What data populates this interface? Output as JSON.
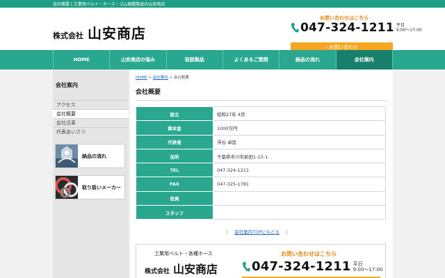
{
  "topbar": {
    "text": "会社概要 | 工業用ベルト・ホース・ゴム樹脂製品の山安商店"
  },
  "header": {
    "logo_small": "株式会社",
    "logo_big": "山安商店",
    "contact_heading": "お問い合わせはこちら",
    "phone": "047-324-1211",
    "hours_line1": "平日",
    "hours_line2": "9:00〜17:00",
    "contact_button": "› お問い合わせ"
  },
  "nav": [
    {
      "label": "HOME"
    },
    {
      "label": "山安商店の強み"
    },
    {
      "label": "取扱製品"
    },
    {
      "label": "よくあるご質問"
    },
    {
      "label": "納品の流れ"
    },
    {
      "label": "会社案内"
    }
  ],
  "sidebar": {
    "title": "会社案内",
    "items": [
      {
        "label": "アクセス"
      },
      {
        "label": "会社概要"
      },
      {
        "label": "会社沿革"
      },
      {
        "label": "代表あいさつ"
      }
    ],
    "banners": [
      {
        "label": "納品の流れ"
      },
      {
        "label": "取り扱いメーカー"
      }
    ]
  },
  "breadcrumb": {
    "home": "HOME",
    "sep": ">",
    "company": "会社案内",
    "current": "会社概要"
  },
  "page_title": "会社概要",
  "company_info": [
    {
      "key": "設立",
      "value": "昭和27年 4月"
    },
    {
      "key": "資本金",
      "value": "1000万円"
    },
    {
      "key": "代表者",
      "value": "浮谷 卓匡"
    },
    {
      "key": "住所",
      "value": "千葉県市川市新田1-15-1"
    },
    {
      "key": "TEL",
      "value": "047-324-1211"
    },
    {
      "key": "FAX",
      "value": "047-325-1781"
    },
    {
      "key": "役員",
      "value": ""
    },
    {
      "key": "スタッフ",
      "value": ""
    }
  ],
  "back_link": {
    "bar": "|",
    "label": "会社案内TOPにもどる"
  },
  "footer_box": {
    "subtitle": "工業用ベルト・各種ホース",
    "logo_small": "株式会社",
    "logo_big": "山安商店",
    "contact_heading": "お問い合わせはこちら",
    "phone": "047-324-1211",
    "hours_line1": "平日",
    "hours_line2": "9:00〜17:00"
  },
  "colors": {
    "accent_green": "#2aa88f",
    "dark_green": "#17806c",
    "orange": "#f5a623",
    "orange_text": "#e8850e"
  }
}
